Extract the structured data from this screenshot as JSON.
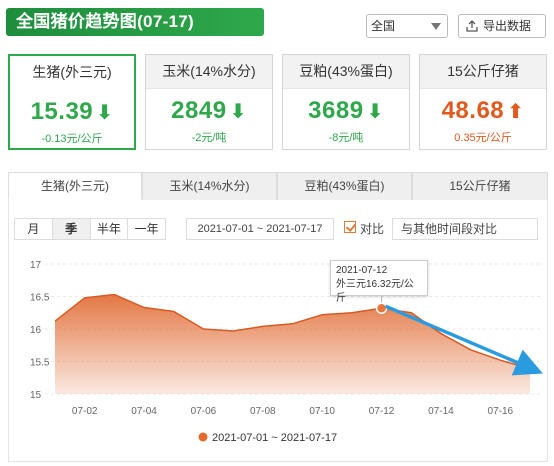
{
  "header": {
    "title": "全国猪价趋势图(07-17)",
    "region": "全国",
    "export_label": "导出数据"
  },
  "cards": [
    {
      "label": "生猪(外三元)",
      "value": "15.39",
      "trend": "down",
      "change": "-0.13元/公斤"
    },
    {
      "label": "玉米(14%水分)",
      "value": "2849",
      "trend": "down",
      "change": "-2元/吨"
    },
    {
      "label": "豆粕(43%蛋白)",
      "value": "3689",
      "trend": "down",
      "change": "-8元/吨"
    },
    {
      "label": "15公斤仔猪",
      "value": "48.68",
      "trend": "up",
      "change": "0.35元/公斤"
    }
  ],
  "tabs": [
    "生猪(外三元)",
    "玉米(14%水分)",
    "豆粕(43%蛋白)",
    "15公斤仔猪"
  ],
  "periods": [
    "月",
    "季",
    "半年",
    "一年"
  ],
  "date_range": "2021-07-01 ~ 2021-07-17",
  "compare": {
    "label": "对比",
    "select_label": "与其他时间段对比"
  },
  "tooltip": {
    "date": "2021-07-12",
    "text": "外三元16.32元/公斤"
  },
  "legend": {
    "label": "2021-07-01 ~ 2021-07-17"
  },
  "colors": {
    "green": "#2fa84b",
    "red": "#e05a1e",
    "area": "#e2703a",
    "arrow": "#2b9be0"
  },
  "chart_data": {
    "type": "area",
    "x": [
      "07-01",
      "07-02",
      "07-03",
      "07-04",
      "07-05",
      "07-06",
      "07-07",
      "07-08",
      "07-09",
      "07-10",
      "07-11",
      "07-12",
      "07-13",
      "07-14",
      "07-15",
      "07-16",
      "07-17"
    ],
    "series": [
      {
        "name": "2021-07-01 ~ 2021-07-17",
        "values": [
          16.12,
          16.48,
          16.53,
          16.33,
          16.27,
          16.0,
          15.97,
          16.04,
          16.08,
          16.22,
          16.25,
          16.32,
          16.25,
          15.93,
          15.68,
          15.52,
          15.39
        ]
      }
    ],
    "x_tick_labels": [
      "07-02",
      "07-04",
      "07-06",
      "07-08",
      "07-10",
      "07-12",
      "07-14",
      "07-16"
    ],
    "y_ticks": [
      15,
      15.5,
      16,
      16.5,
      17
    ],
    "ylim": [
      15,
      17
    ],
    "grid": true,
    "legend_position": "bottom"
  }
}
